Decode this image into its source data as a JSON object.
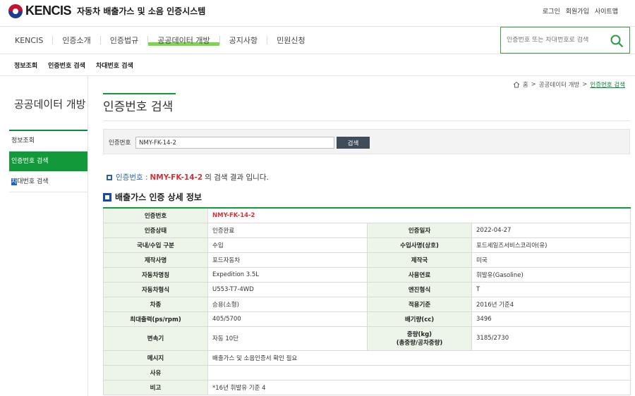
{
  "header": {
    "logo_text": "KENCIS",
    "system_name": "자동차 배출가스 및 소음 인증시스템",
    "util_links": [
      "로그인",
      "회원가입",
      "사이트맵"
    ]
  },
  "gnb": {
    "items": [
      "KENCIS",
      "인증소개",
      "인증법규",
      "공공데이터 개방",
      "공지사항",
      "민원신청"
    ],
    "highlight_color": "#7bd64c",
    "search_placeholder": "인증번호 또는 차대번호로 검색"
  },
  "subnav": [
    "정보조회",
    "인증번호 검색",
    "차대번호 검색"
  ],
  "sidebar": {
    "title": "공공데이터 개방",
    "items": [
      "정보조회",
      "인증번호 검색",
      "차",
      "대번호 검색"
    ],
    "active_color": "#129a3a"
  },
  "breadcrumb": {
    "home": "홈",
    "level1": "공공데이터 개방",
    "current": "인증번호 검색"
  },
  "page_title": "인증번호 검색",
  "search": {
    "label": "인증번호",
    "value": "NMY-FK-14-2",
    "button": "검색"
  },
  "result_line": {
    "prefix": "인증번호 :",
    "number": "NMY-FK-14-2",
    "suffix": "의 검색 결과 입니다."
  },
  "section_title": "배출가스 인증 상세 정보",
  "details": {
    "cert_no_label": "인증번호",
    "cert_no": "NMY-FK-14-2",
    "status_label": "인증상태",
    "status": "인증완료",
    "cert_date_label": "인증일자",
    "cert_date": "2022-04-27",
    "origin_label": "국내/수입 구분",
    "origin": "수입",
    "importer_label": "수입사명(상호)",
    "importer": "포드세일즈서비스코리아(유)",
    "maker_label": "제작사명",
    "maker": "포드자동차",
    "country_label": "제작국",
    "country": "미국",
    "model_label": "자동차명칭",
    "model": "Expedition 3.5L",
    "fuel_label": "사용연료",
    "fuel": "휘발유(Gasoline)",
    "type_label": "자동차형식",
    "type": "U553-T7-4WD",
    "engine_label": "엔진형식",
    "engine": "T",
    "class_label": "차종",
    "class": "승용(소형)",
    "standard_label": "적용기준",
    "standard": "2016년 기준4",
    "power_label": "최대출력(ps/rpm)",
    "power": "405/5700",
    "displacement_label": "배기량(cc)",
    "displacement": "3496",
    "trans_label": "변속기",
    "trans": "자동 10단",
    "weight_label": "중량(kg)",
    "weight_label2": "(총중량/공차중량)",
    "weight": "3185/2730",
    "message_label": "메시지",
    "message": "배출가스 및 소음인증서 확인 필요",
    "reason_label": "사유",
    "reason": "",
    "note_label": "비고",
    "note": "*16년 휘발유 기준 4"
  }
}
